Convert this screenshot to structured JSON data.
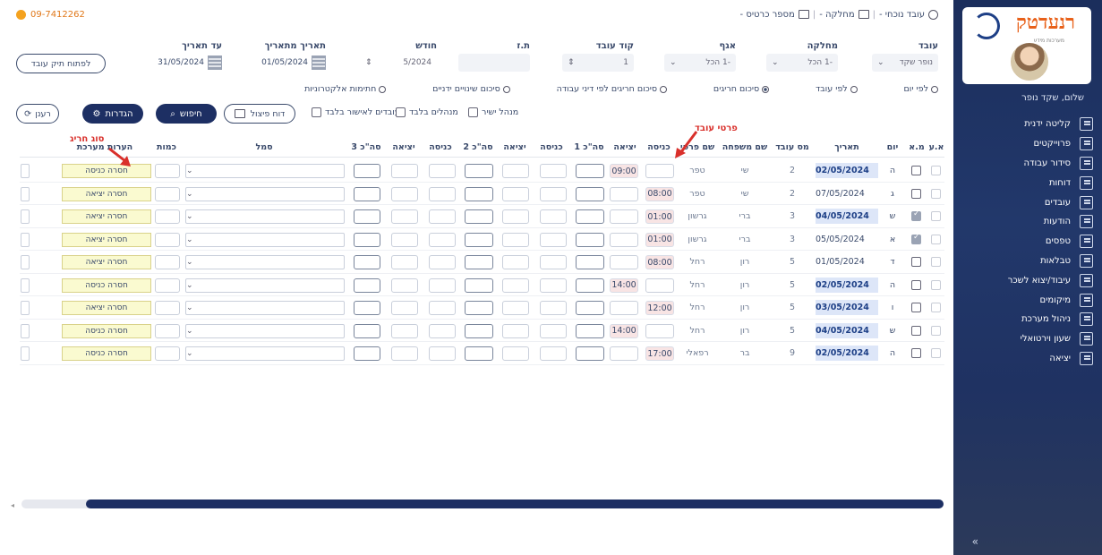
{
  "sidebar": {
    "logo_text": "רנעדטק",
    "logo_sub": "מערכות מידע",
    "user_name": "שלום, שקד נופר",
    "items": [
      {
        "label": "קליטה ידנית",
        "icon": "hand-entry-icon"
      },
      {
        "label": "פרוייקטים",
        "icon": "projects-icon"
      },
      {
        "label": "סידור עבודה",
        "icon": "schedule-icon"
      },
      {
        "label": "דוחות",
        "icon": "reports-icon"
      },
      {
        "label": "עובדים",
        "icon": "employees-icon"
      },
      {
        "label": "הודעות",
        "icon": "messages-icon"
      },
      {
        "label": "טפסים",
        "icon": "forms-icon"
      },
      {
        "label": "טבלאות",
        "icon": "tables-icon"
      },
      {
        "label": "עיבוד/יצוא לשכר",
        "icon": "payroll-export-icon"
      },
      {
        "label": "מיקומים",
        "icon": "locations-icon"
      },
      {
        "label": "ניהול מערכת",
        "icon": "system-admin-icon"
      },
      {
        "label": "שעון וירטואלי",
        "icon": "virtual-clock-icon"
      },
      {
        "label": "יציאה",
        "icon": "logout-icon"
      }
    ],
    "expand_glyph": "»"
  },
  "topbar": {
    "phone": "09-7412262",
    "current_employee": "עובד נוכחי -",
    "department": "מחלקה -",
    "card_number": "מספר כרטיס -",
    "sep": "|"
  },
  "filters": {
    "employee": {
      "label": "עובד",
      "value": "נופר שקד"
    },
    "department": {
      "label": "מחלקה",
      "value": "-1 הכל"
    },
    "wing": {
      "label": "אגף",
      "value": "-1 הכל"
    },
    "employee_code": {
      "label": "קוד עובד",
      "value": "1"
    },
    "id_number": {
      "label": "ת.ז",
      "value": ""
    },
    "month": {
      "label": "חודש",
      "value": "5/2024"
    },
    "from_date": {
      "label": "תאריך מתאריך",
      "value": "01/05/2024"
    },
    "to_date": {
      "label": "עד תאריך",
      "value": "31/05/2024"
    },
    "open_file_button": "לפתוח תיק עובד"
  },
  "radios": [
    {
      "label": "לפי יום",
      "checked": false
    },
    {
      "label": "לפי עובד",
      "checked": false
    },
    {
      "label": "סיכום חריגים",
      "checked": true
    },
    {
      "label": "סיכום חריגים לפי דיני עבודה",
      "checked": false
    },
    {
      "label": "סיכום שינויים ידניים",
      "checked": false
    },
    {
      "label": "חתימות אלקטרוניות",
      "checked": false
    }
  ],
  "actions": {
    "direct_manager": "מנהל ישיר",
    "managers_only": "מנהלים בלבד",
    "pending_approval": "עובדים לאישור בלבד",
    "split_report": "דוח פיצול",
    "search": "חיפוש",
    "settings": "הגדרות",
    "refresh": "רענן"
  },
  "table": {
    "headers": {
      "av": "א.ע",
      "mn": "מ.א",
      "day": "יום",
      "date": "תאריך",
      "emp_no": "מס עובד",
      "last_name": "שם משפחה",
      "first_name": "שם פרטי",
      "in1": "כניסה",
      "out1": "יציאה",
      "total1": "סה\"כ 1",
      "in2": "כניסה",
      "out2": "יציאה",
      "total2": "סה\"כ 2",
      "in3": "כניסה",
      "out3": "יציאה",
      "total3": "סה\"כ 3",
      "symbol": "סמל",
      "qty": "כמות",
      "notes": "הערות מערכת"
    },
    "rows": [
      {
        "mn": false,
        "day": "ה",
        "date": "02/05/2024",
        "hl": true,
        "emp_no": "2",
        "last_name": "שי",
        "first_name": "טפר",
        "in1": "",
        "out1": "09:00",
        "note": "חסרה כניסה"
      },
      {
        "mn": false,
        "day": "ג",
        "date": "07/05/2024",
        "hl": false,
        "emp_no": "2",
        "last_name": "שי",
        "first_name": "טפר",
        "in1": "08:00",
        "out1": "",
        "note": "חסרה יציאה"
      },
      {
        "mn": true,
        "day": "ש",
        "date": "04/05/2024",
        "hl": true,
        "emp_no": "3",
        "last_name": "ברי",
        "first_name": "גרשון",
        "in1": "01:00",
        "out1": "",
        "note": "חסרה יציאה"
      },
      {
        "mn": true,
        "day": "א",
        "date": "05/05/2024",
        "hl": false,
        "emp_no": "3",
        "last_name": "ברי",
        "first_name": "גרשון",
        "in1": "01:00",
        "out1": "",
        "note": "חסרה יציאה"
      },
      {
        "mn": false,
        "day": "ד",
        "date": "01/05/2024",
        "hl": false,
        "emp_no": "5",
        "last_name": "רון",
        "first_name": "רחל",
        "in1": "08:00",
        "out1": "",
        "note": "חסרה יציאה"
      },
      {
        "mn": false,
        "day": "ה",
        "date": "02/05/2024",
        "hl": true,
        "emp_no": "5",
        "last_name": "רון",
        "first_name": "רחל",
        "in1": "",
        "out1": "14:00",
        "note": "חסרה כניסה"
      },
      {
        "mn": false,
        "day": "ו",
        "date": "03/05/2024",
        "hl": true,
        "emp_no": "5",
        "last_name": "רון",
        "first_name": "רחל",
        "in1": "12:00",
        "out1": "",
        "note": "חסרה יציאה"
      },
      {
        "mn": false,
        "day": "ש",
        "date": "04/05/2024",
        "hl": true,
        "emp_no": "5",
        "last_name": "רון",
        "first_name": "רחל",
        "in1": "",
        "out1": "14:00",
        "note": "חסרה כניסה"
      },
      {
        "mn": false,
        "day": "ה",
        "date": "02/05/2024",
        "hl": true,
        "emp_no": "9",
        "last_name": "בר",
        "first_name": "רפאלי",
        "in1": "17:00",
        "out1": "",
        "note": "חסרה כניסה"
      }
    ]
  },
  "annotations": {
    "employee_details": "פרטי עובד",
    "exception_type": "סוג חריג"
  },
  "colors": {
    "sidebar": "#1b2e5c",
    "primary": "#1d2f63",
    "accent_orange": "#e0781a",
    "annotation_red": "#d9302b",
    "note_yellow": "#fafad0"
  }
}
